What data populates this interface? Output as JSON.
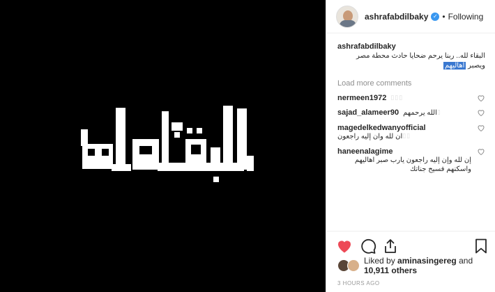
{
  "header": {
    "username": "ashrafabdilbaky",
    "verified_mark": "✓",
    "separator": "•",
    "follow_status": "Following"
  },
  "caption": {
    "username": "ashrafabdilbaky",
    "text_main": "البقاء لله.. ربنا يرحم ضحايا حادث محطة مصر ويصبر",
    "text_highlight": "أهاليهم"
  },
  "load_more": "Load more comments",
  "comments": [
    {
      "username": "nermeen1972",
      "text": "",
      "emoji": "▯▯▯"
    },
    {
      "username": "sajad_alameer90",
      "text": "الله يرحمهم",
      "emoji": "▯"
    },
    {
      "username": "magedelkedwanyofficial",
      "text": "ان لله وان إليه راجعون",
      "emoji": "▯▯"
    },
    {
      "username": "haneenalagime",
      "text": "إن لله وإن إليه راجعون يارب صبر اهاليهم واسكنهم فسيح جناتك",
      "emoji": ""
    }
  ],
  "likes": {
    "prefix": "Liked by",
    "user": "aminasingereg",
    "connector": "and",
    "count": "10,911 others"
  },
  "timestamp": "3 HOURS AGO",
  "icons": {
    "like": "heart-filled-icon",
    "comment": "comment-icon",
    "share": "share-icon",
    "save": "bookmark-icon"
  },
  "colors": {
    "like": "#ed4956",
    "verified": "#3897f0",
    "highlight": "#3a78d0",
    "media_bg": "#000000"
  },
  "media_alt": "البقاء لله"
}
